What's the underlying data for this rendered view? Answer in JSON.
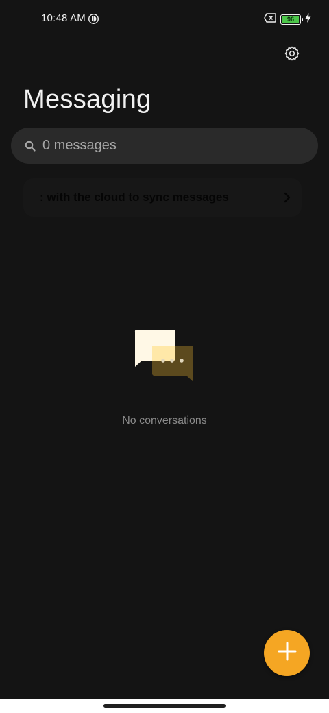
{
  "status_bar": {
    "time": "10:48 AM",
    "battery_level": "96",
    "battery_fraction": 0.96,
    "icons": [
      "app-notification-icon",
      "sim-error-icon",
      "battery-icon",
      "charging-bolt-icon"
    ]
  },
  "header": {
    "title": "Messaging",
    "settings_icon": "gear-icon"
  },
  "search": {
    "placeholder": "0 messages",
    "icon": "search-icon"
  },
  "sync_banner": {
    "text": ": with the cloud to sync messages",
    "icon": "chevron-right-icon"
  },
  "empty_state": {
    "text": "No conversations",
    "icon": "chat-bubbles-icon"
  },
  "fab": {
    "icon": "plus-icon"
  },
  "colors": {
    "background": "#141414",
    "accent": "#f5a623",
    "search_bg": "#2a2a2a",
    "battery_green": "#4cc64a"
  }
}
